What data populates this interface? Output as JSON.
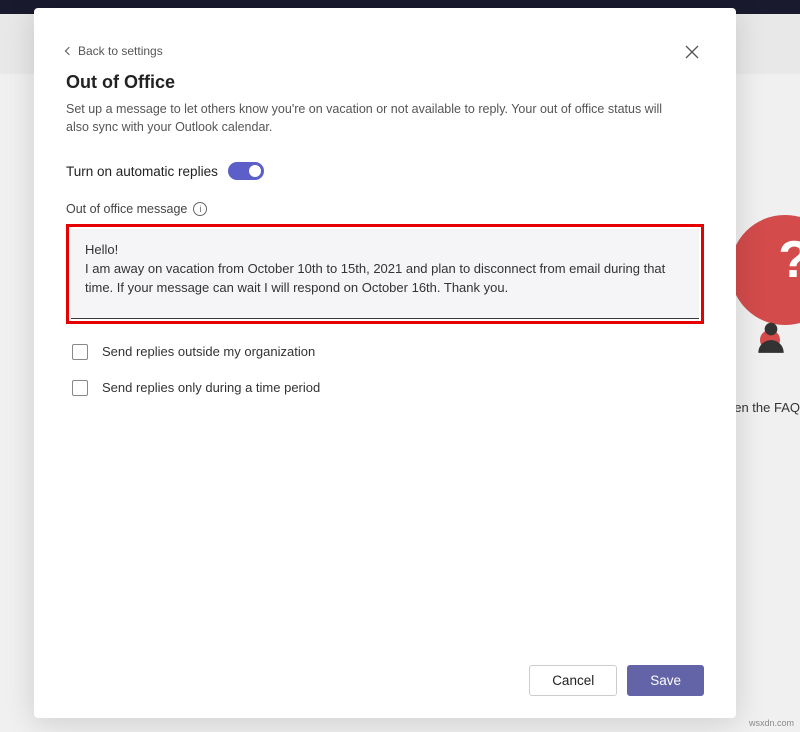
{
  "back_link": "Back to settings",
  "title": "Out of Office",
  "description": "Set up a message to let others know you're on vacation or not available to reply. Your out of office status will also sync with your Outlook calendar.",
  "toggle": {
    "label": "Turn on automatic replies",
    "on": true
  },
  "message": {
    "label": "Out of office message",
    "content": "Hello!\nI am away on vacation from October 10th to 15th, 2021 and plan to disconnect from email during that time. If your message can wait I will respond on October 16th. Thank you."
  },
  "options": {
    "outside_org": "Send replies outside my organization",
    "time_period": "Send replies only during a time period"
  },
  "buttons": {
    "cancel": "Cancel",
    "save": "Save"
  },
  "bg": {
    "faq_text": "en the FAQ"
  },
  "watermark": "wsxdn.com",
  "colors": {
    "accent": "#6264a7",
    "highlight": "#e60000"
  }
}
